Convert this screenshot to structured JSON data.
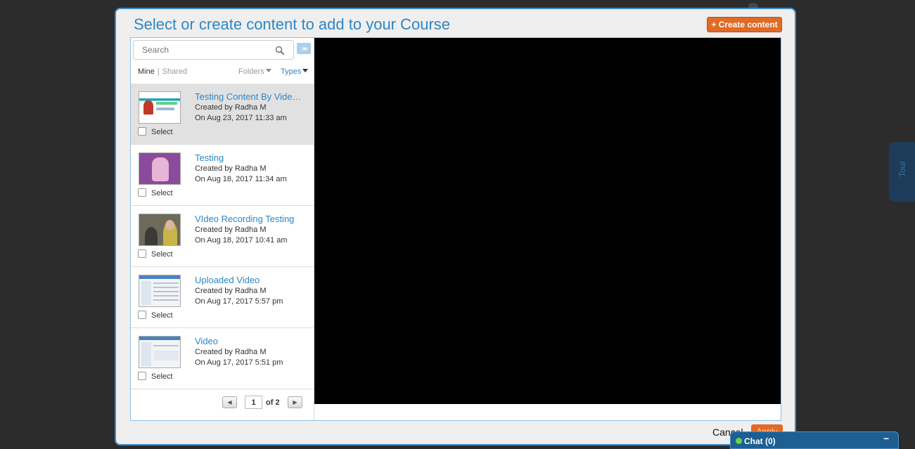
{
  "modal": {
    "title": "Select or create content to add to your Course",
    "create_button": "+ Create content",
    "cancel_button": "Cancel",
    "apply_button": "Apply"
  },
  "search": {
    "placeholder": "Search"
  },
  "filters": {
    "mine": "Mine",
    "separator": "|",
    "shared": "Shared",
    "folders": "Folders",
    "types": "Types"
  },
  "items": [
    {
      "title": "Testing Content By Vide…",
      "created_by": "Created by Radha M",
      "date": "On Aug 23, 2017 11:33 am",
      "select_label": "Select"
    },
    {
      "title": "Testing",
      "created_by": "Created by Radha M",
      "date": "On Aug 18, 2017 11:34 am",
      "select_label": "Select"
    },
    {
      "title": "VIdeo Recording Testing",
      "created_by": "Created by Radha M",
      "date": "On Aug 18, 2017 10:41 am",
      "select_label": "Select"
    },
    {
      "title": "Uploaded Video",
      "created_by": "Created by Radha M",
      "date": "On Aug 17, 2017 5:57 pm",
      "select_label": "Select"
    },
    {
      "title": "Video",
      "created_by": "Created by Radha M",
      "date": "On Aug 17, 2017 5:51 pm",
      "select_label": "Select"
    }
  ],
  "pager": {
    "current_page": "1",
    "of_total": "of 2"
  },
  "side_tab": {
    "label": "Tour"
  },
  "chat": {
    "label": "Chat  (0)",
    "minimize": "−"
  },
  "colors": {
    "accent": "#2e86c4",
    "button_orange": "#e06a26",
    "backdrop": "#2c2c2c",
    "chat_bar": "#1d5e93"
  }
}
